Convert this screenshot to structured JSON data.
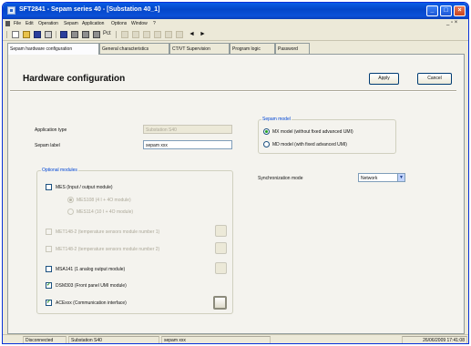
{
  "window": {
    "title": "SFT2841 - Sepam series 40 - [Substation 40_1]",
    "controls": {
      "minimize": "_",
      "maximize": "□",
      "close": "×"
    }
  },
  "menubar": {
    "items": [
      "File",
      "Edit",
      "Operation",
      "Sepam",
      "Application",
      "Options",
      "Window",
      "?"
    ],
    "mdi_controls": "_ ▫ ×"
  },
  "toolbar": {
    "text_tool": "Pct"
  },
  "tabs": [
    {
      "label": "Sepam hardware configuration",
      "active": true
    },
    {
      "label": "General characteristics",
      "active": false
    },
    {
      "label": "CT/VT Supervision",
      "active": false
    },
    {
      "label": "Program logic",
      "active": false
    },
    {
      "label": "Password",
      "active": false
    }
  ],
  "header": {
    "title": "Hardware configuration",
    "apply_label": "Apply",
    "cancel_label": "Cancel"
  },
  "fields": {
    "application_type_label": "Application type",
    "application_type_value": "Substation S40",
    "sepam_label_label": "Sepam label",
    "sepam_label_value": "sepam xxx"
  },
  "optional_modules": {
    "group_label": "Optional modules",
    "mes": {
      "label": "MES (Input / output module)",
      "checked": false
    },
    "mes_variants": [
      {
        "label": "MES108 (4 I + 4O module)",
        "selected": true
      },
      {
        "label": "MES114 (10 I + 4O module)",
        "selected": false
      }
    ],
    "mets1": {
      "label": "MET148-2 (temperature sensors module number 1)",
      "checked": false
    },
    "mets2": {
      "label": "MET148-2 (temperature sensors module number 2)",
      "checked": false
    },
    "msa": {
      "label": "MSA141 (1 analog output module)",
      "checked": false
    },
    "dsm": {
      "label": "DSM303 (Front panel UMI module)",
      "checked": true
    },
    "ace": {
      "label": "ACExxx (Communication interface)",
      "checked": true
    }
  },
  "sepam_model": {
    "group_label": "Sepam model",
    "options": [
      {
        "label": "MX model (without fixed advanced UMI)",
        "selected": true
      },
      {
        "label": "MD model (with fixed advanced UMI)",
        "selected": false
      }
    ]
  },
  "sync": {
    "label": "Synchronization mode",
    "value": "Network",
    "arrow": "▼"
  },
  "statusbar": {
    "connection": "Disconnected",
    "substation": "Substation S40",
    "sepam": "sepam xxx",
    "datetime": "26/06/2009  17:41:08"
  }
}
